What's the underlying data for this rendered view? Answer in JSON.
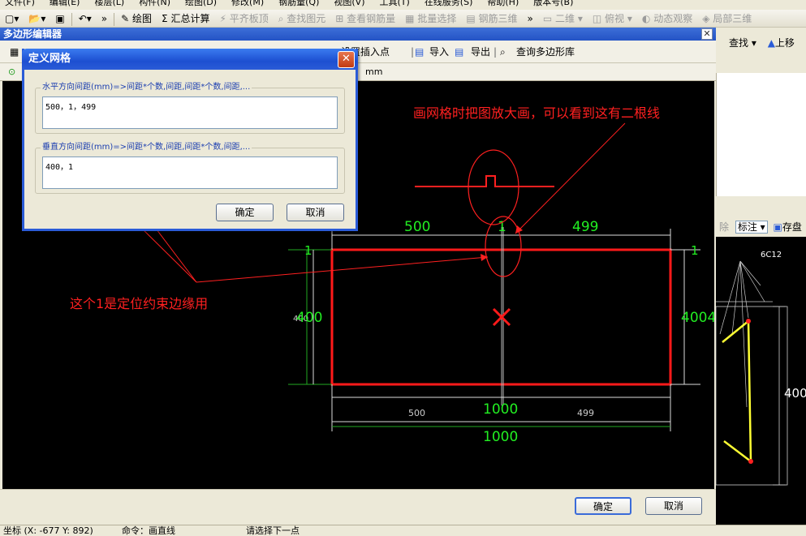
{
  "menu": [
    "文件(F)",
    "编辑(E)",
    "楼层(L)",
    "构件(N)",
    "绘图(D)",
    "修改(M)",
    "钢筋量(Q)",
    "视图(V)",
    "工具(T)",
    "在线服务(S)",
    "帮助(H)",
    "版本号(B)"
  ],
  "toolbar": {
    "draw": "绘图",
    "sum": "汇总计算",
    "flat_top": "平齐板顶",
    "find_elem": "查找图元",
    "view_rebar": "查看钢筋量",
    "batch_select": "批量选择",
    "rebar_3d": "钢筋三维",
    "view_2d": "二维",
    "view_top": "俯视",
    "dynamic_view": "动态观察",
    "local_3d": "局部三维"
  },
  "editor": {
    "title": "多边形编辑器",
    "set_insert_point": "设置插入点",
    "import": "导入",
    "export": "导出",
    "query_library": "查询多边形库",
    "unit": "mm",
    "ok": "确定",
    "cancel": "取消"
  },
  "right_panel": {
    "find": "查找",
    "move_up": "上移",
    "remove": "除",
    "annotate": "标注",
    "save": "存盘",
    "rebar_label": "6C12",
    "dim_400": "400"
  },
  "dialog": {
    "title": "定义网格",
    "horizontal_label": "水平方向间距(mm)=>间距*个数,间距,间距*个数,间距,...",
    "horizontal_value": "500，1，499",
    "vertical_label": "垂直方向间距(mm)=>间距*个数,间距,间距*个数,间距,...",
    "vertical_value": "400，1",
    "ok": "确定",
    "cancel": "取消"
  },
  "canvas": {
    "annotation_top": "画网格时把图放大画，可以看到这有二根线",
    "annotation_left": "这个1是定位约束边缘用",
    "dim_top_left": "500",
    "dim_top_mid": "1",
    "dim_top_right": "499",
    "dim_left_1": "1",
    "dim_right_1": "1",
    "dim_left_400": "400",
    "dim_left_400_small": "400",
    "dim_right_4004": "4004",
    "dim_bottom_1000": "1000",
    "dim_bottom_500": "500",
    "dim_bottom_499": "499",
    "dim_total_1000": "1000"
  },
  "status": {
    "coords": "坐标 (X: -677 Y: 892)",
    "command": "命令：画直线",
    "prompt": "请选择下一点"
  },
  "colors": {
    "annotation_red": "#ff2020",
    "dimension_green": "#22ee22",
    "rect_red": "#ff1a1a",
    "dialog_blue": "#2a5bd7"
  }
}
